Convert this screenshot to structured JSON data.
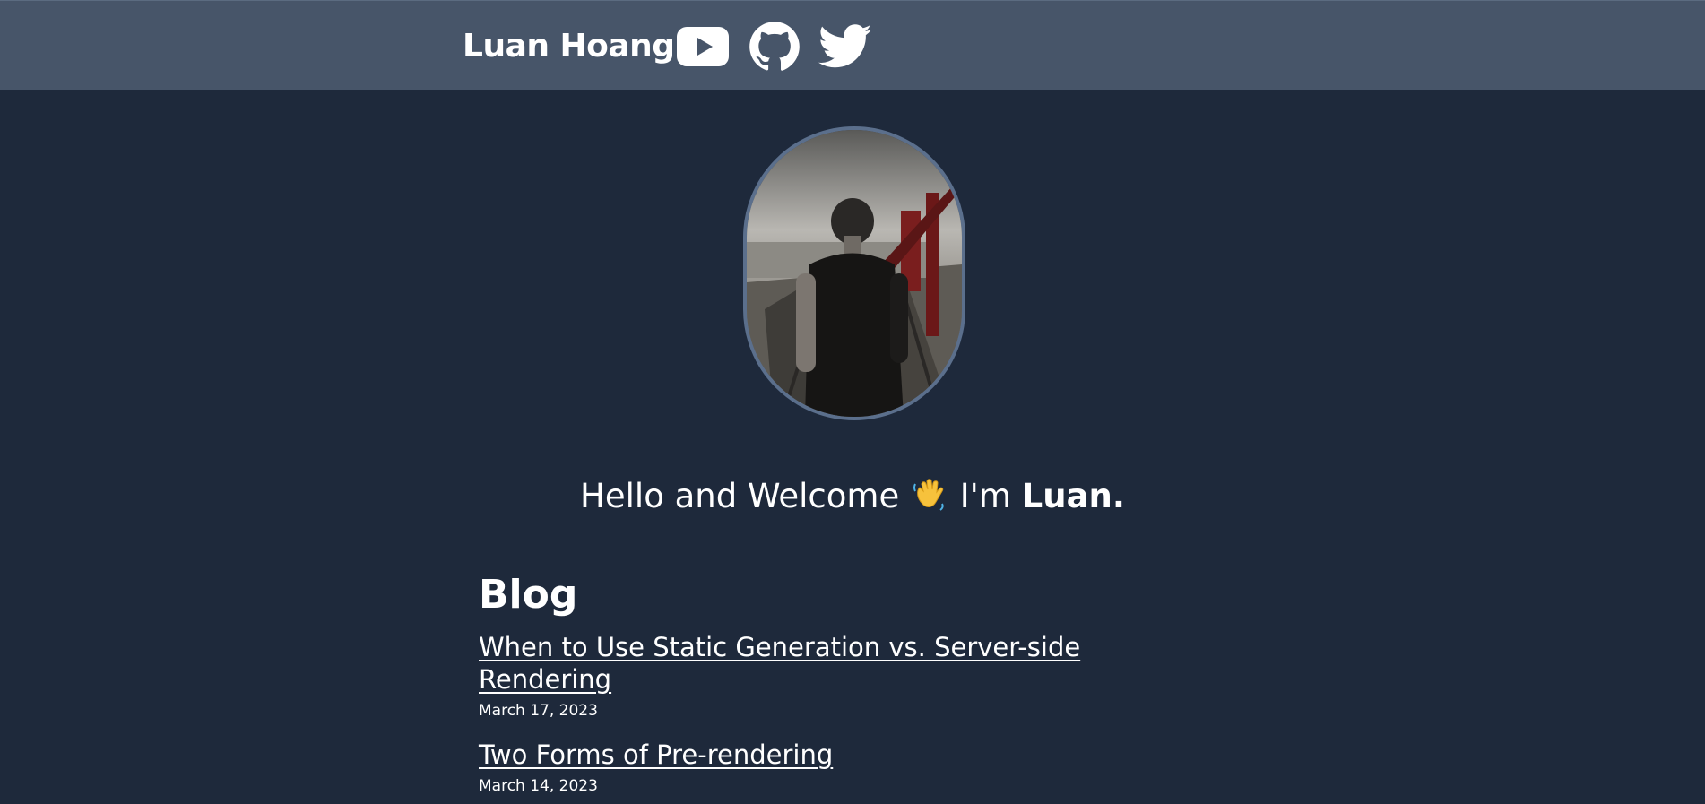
{
  "header": {
    "brand": "Luan Hoang",
    "social": [
      {
        "icon": "youtube-icon"
      },
      {
        "icon": "github-icon"
      },
      {
        "icon": "twitter-icon"
      }
    ]
  },
  "profile": {
    "avatar_icon": "profile-photo"
  },
  "hero": {
    "greeting": "Hello and Welcome",
    "emoji": "👋",
    "im": "I'm",
    "name": "Luan."
  },
  "blog": {
    "title": "Blog",
    "posts": [
      {
        "title": "When to Use Static Generation vs. Server-side Rendering",
        "date": "March 17, 2023"
      },
      {
        "title": "Two Forms of Pre-rendering",
        "date": "March 14, 2023"
      }
    ]
  },
  "colors": {
    "background": "#1e293b",
    "header": "#475569",
    "text": "#ffffff"
  }
}
